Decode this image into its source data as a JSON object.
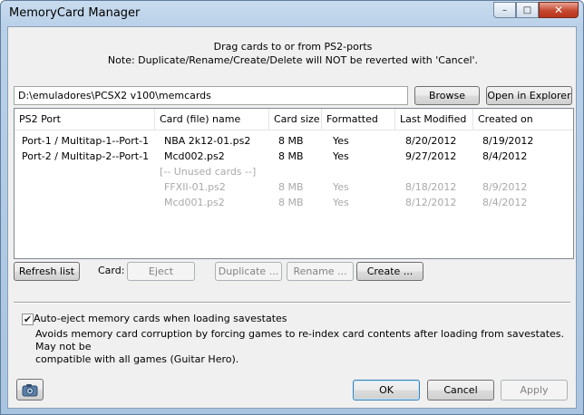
{
  "window": {
    "title": "MemoryCard Manager",
    "caption": {
      "minimize": "–",
      "maximize": "□",
      "close": "✕"
    }
  },
  "info": {
    "line1": "Drag cards to or from PS2-ports",
    "line2": "Note: Duplicate/Rename/Create/Delete will NOT be reverted with 'Cancel'."
  },
  "folder": {
    "path": "D:\\emuladores\\PCSX2 v100\\memcards",
    "browse_label": "Browse",
    "open_explorer_label": "Open in Explorer"
  },
  "table": {
    "columns": [
      "PS2 Port",
      "Card (file) name",
      "Card size",
      "Formatted",
      "Last Modified",
      "Created on"
    ],
    "rows": [
      {
        "port": "Port-1 / Multitap-1--Port-1",
        "name": "NBA 2k12-01.ps2",
        "size": "8 MB",
        "formatted": "Yes",
        "modified": "8/20/2012",
        "created": "8/19/2012"
      },
      {
        "port": "Port-2 / Multitap-2--Port-1",
        "name": "Mcd002.ps2",
        "size": "8 MB",
        "formatted": "Yes",
        "modified": "9/27/2012",
        "created": "8/4/2012"
      }
    ],
    "unused_label": "[-- Unused cards --]",
    "unused_rows": [
      {
        "name": "FFXII-01.ps2",
        "size": "8 MB",
        "formatted": "Yes",
        "modified": "8/18/2012",
        "created": "8/9/2012"
      },
      {
        "name": "Mcd001.ps2",
        "size": "8 MB",
        "formatted": "Yes",
        "modified": "8/12/2012",
        "created": "8/4/2012"
      }
    ]
  },
  "card_actions": {
    "refresh_label": "Refresh list",
    "card_label": "Card:",
    "eject_label": "Eject",
    "duplicate_label": "Duplicate ...",
    "rename_label": "Rename ...",
    "create_label": "Create ..."
  },
  "options": {
    "auto_eject_checked": true,
    "auto_eject_check_glyph": "✔",
    "auto_eject_label": "Auto-eject memory cards when loading savestates",
    "auto_eject_desc_line1": "Avoids memory card corruption by forcing games to re-index card contents after loading from savestates.  May not be",
    "auto_eject_desc_line2": "compatible with all games (Guitar Hero)."
  },
  "footer": {
    "ok_label": "OK",
    "cancel_label": "Cancel",
    "apply_label": "Apply",
    "screenshot_icon": "camera-icon"
  }
}
